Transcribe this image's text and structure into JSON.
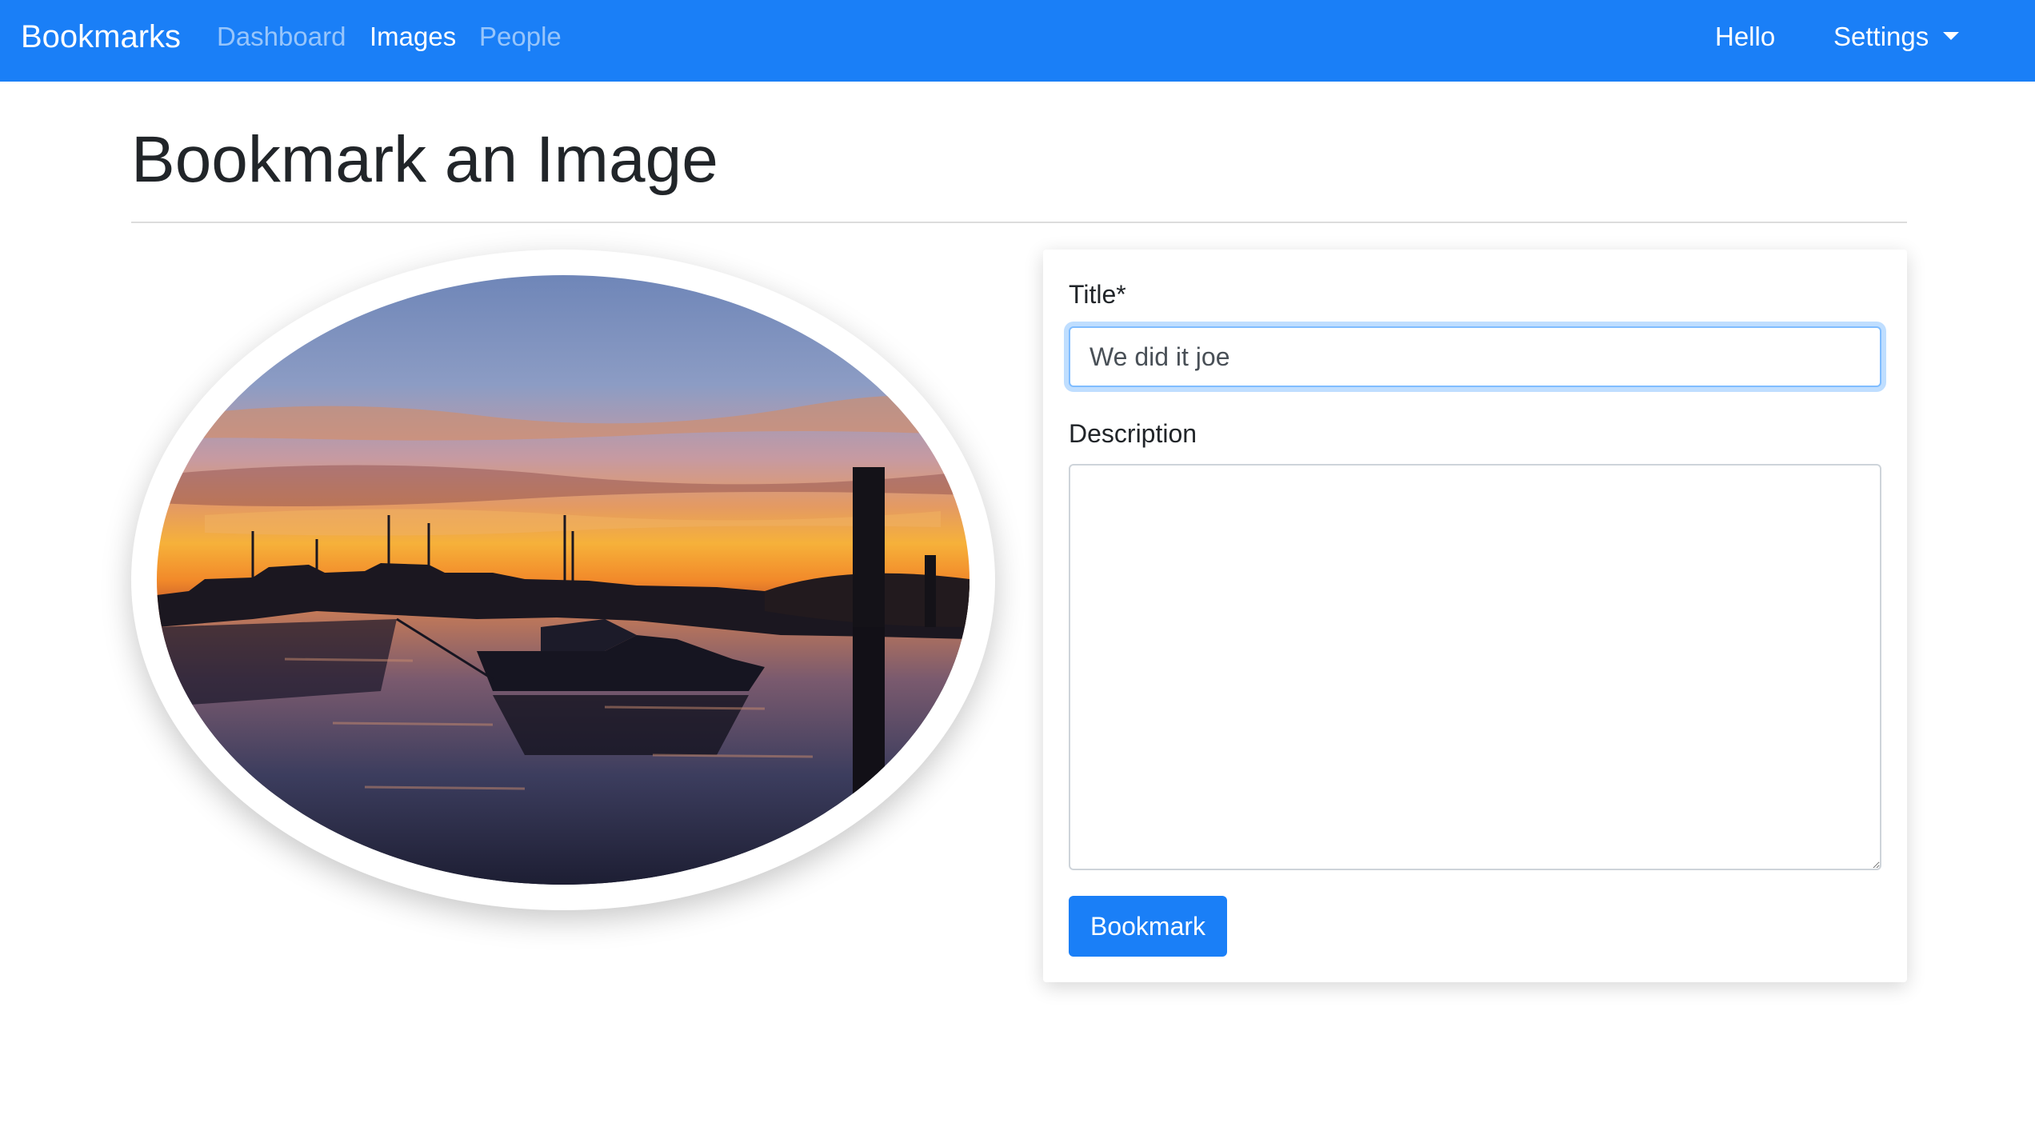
{
  "navbar": {
    "brand": "Bookmarks",
    "links": [
      "Dashboard",
      "Images",
      "People"
    ],
    "active_link": "Images",
    "hello": "Hello",
    "settings": "Settings",
    "color": "#1a7ff7"
  },
  "page": {
    "title": "Bookmark an Image"
  },
  "image": {
    "subject": "sunset over harbor with silhouetted boats"
  },
  "form": {
    "title_label": "Title*",
    "title_value": "We did it joe",
    "description_label": "Description",
    "description_value": "",
    "submit_label": "Bookmark"
  }
}
